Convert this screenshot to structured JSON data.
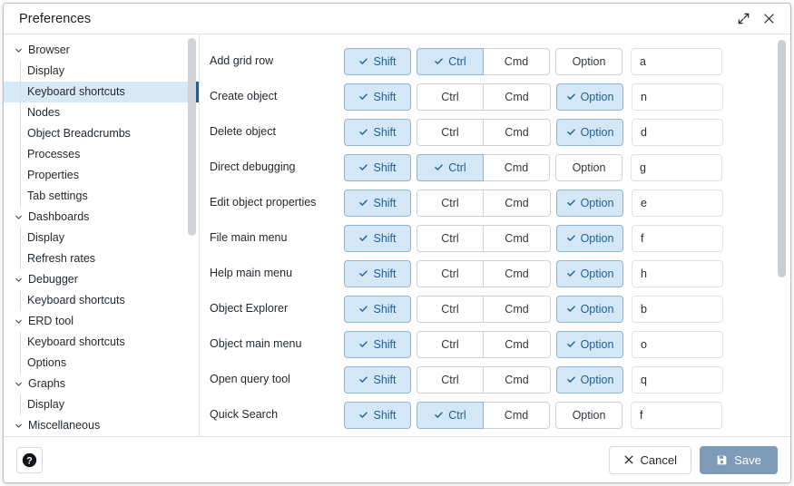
{
  "window": {
    "title": "Preferences",
    "expand_icon": "expand-icon",
    "close_icon": "close-icon"
  },
  "sidebar": {
    "items": [
      {
        "label": "Browser",
        "level": "group",
        "expanded": true,
        "selected": false
      },
      {
        "label": "Display",
        "level": "child",
        "expanded": false,
        "selected": false
      },
      {
        "label": "Keyboard shortcuts",
        "level": "child",
        "expanded": false,
        "selected": true
      },
      {
        "label": "Nodes",
        "level": "child",
        "expanded": false,
        "selected": false
      },
      {
        "label": "Object Breadcrumbs",
        "level": "child",
        "expanded": false,
        "selected": false
      },
      {
        "label": "Processes",
        "level": "child",
        "expanded": false,
        "selected": false
      },
      {
        "label": "Properties",
        "level": "child",
        "expanded": false,
        "selected": false
      },
      {
        "label": "Tab settings",
        "level": "child",
        "expanded": false,
        "selected": false
      },
      {
        "label": "Dashboards",
        "level": "group",
        "expanded": true,
        "selected": false
      },
      {
        "label": "Display",
        "level": "child",
        "expanded": false,
        "selected": false
      },
      {
        "label": "Refresh rates",
        "level": "child",
        "expanded": false,
        "selected": false
      },
      {
        "label": "Debugger",
        "level": "group",
        "expanded": true,
        "selected": false
      },
      {
        "label": "Keyboard shortcuts",
        "level": "child",
        "expanded": false,
        "selected": false
      },
      {
        "label": "ERD tool",
        "level": "group",
        "expanded": true,
        "selected": false
      },
      {
        "label": "Keyboard shortcuts",
        "level": "child",
        "expanded": false,
        "selected": false
      },
      {
        "label": "Options",
        "level": "child",
        "expanded": false,
        "selected": false
      },
      {
        "label": "Graphs",
        "level": "group",
        "expanded": true,
        "selected": false
      },
      {
        "label": "Display",
        "level": "child",
        "expanded": false,
        "selected": false
      },
      {
        "label": "Miscellaneous",
        "level": "group",
        "expanded": true,
        "selected": false
      }
    ]
  },
  "shortcuts": {
    "modifier_labels": {
      "shift": "Shift",
      "ctrl": "Ctrl",
      "cmd": "Cmd",
      "option": "Option"
    },
    "rows": [
      {
        "action": "Add grid row",
        "shift": true,
        "ctrl": true,
        "cmd": false,
        "option": false,
        "key": "a"
      },
      {
        "action": "Create object",
        "shift": true,
        "ctrl": false,
        "cmd": false,
        "option": true,
        "key": "n"
      },
      {
        "action": "Delete object",
        "shift": true,
        "ctrl": false,
        "cmd": false,
        "option": true,
        "key": "d"
      },
      {
        "action": "Direct debugging",
        "shift": true,
        "ctrl": true,
        "cmd": false,
        "option": false,
        "key": "g"
      },
      {
        "action": "Edit object properties",
        "shift": true,
        "ctrl": false,
        "cmd": false,
        "option": true,
        "key": "e"
      },
      {
        "action": "File main menu",
        "shift": true,
        "ctrl": false,
        "cmd": false,
        "option": true,
        "key": "f"
      },
      {
        "action": "Help main menu",
        "shift": true,
        "ctrl": false,
        "cmd": false,
        "option": true,
        "key": "h"
      },
      {
        "action": "Object Explorer",
        "shift": true,
        "ctrl": false,
        "cmd": false,
        "option": true,
        "key": "b"
      },
      {
        "action": "Object main menu",
        "shift": true,
        "ctrl": false,
        "cmd": false,
        "option": true,
        "key": "o"
      },
      {
        "action": "Open query tool",
        "shift": true,
        "ctrl": false,
        "cmd": false,
        "option": true,
        "key": "q"
      },
      {
        "action": "Quick Search",
        "shift": true,
        "ctrl": true,
        "cmd": false,
        "option": false,
        "key": "f"
      }
    ]
  },
  "footer": {
    "help_icon": "help-icon",
    "cancel_label": "Cancel",
    "save_label": "Save",
    "cancel_icon": "close-x-icon",
    "save_icon": "save-disk-icon"
  },
  "colors": {
    "accent_selected": "#d4e7f7",
    "accent_border": "#8db4d4",
    "accent_text": "#1f5f95",
    "sidebar_selected": "#d7e9f7",
    "sidebar_indicator": "#1b5e9e",
    "save_button": "#7e9cb8"
  }
}
